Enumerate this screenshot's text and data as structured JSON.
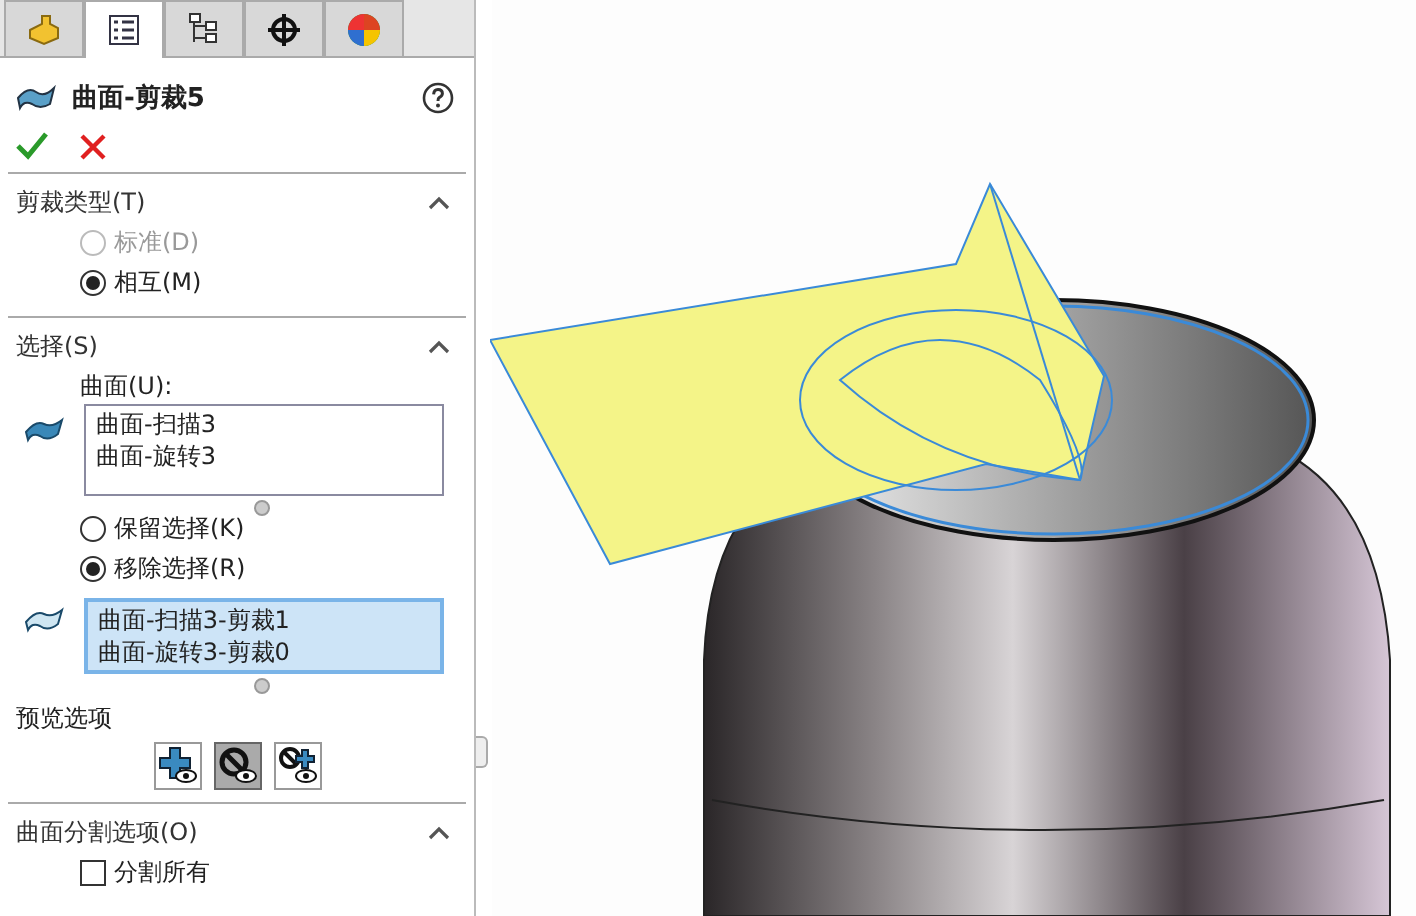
{
  "tabs": [
    {
      "kind": "feature-manager",
      "selected": false
    },
    {
      "kind": "property-manager",
      "selected": true
    },
    {
      "kind": "configuration-manager",
      "selected": false
    },
    {
      "kind": "dimxpert-manager",
      "selected": false
    },
    {
      "kind": "display-manager",
      "selected": false
    }
  ],
  "title": "曲面-剪裁5",
  "trim_type": {
    "title": "剪裁类型(T)",
    "expanded": true,
    "options": [
      {
        "label": "标准(D)",
        "selected": false,
        "disabled": true
      },
      {
        "label": "相互(M)",
        "selected": true,
        "disabled": false
      }
    ]
  },
  "selection": {
    "title": "选择(S)",
    "expanded": true,
    "surfaces_label": "曲面(U):",
    "surfaces": [
      "曲面-扫描3",
      "曲面-旋转3"
    ],
    "options": [
      {
        "label": "保留选择(K)",
        "selected": false,
        "disabled": false
      },
      {
        "label": "移除选择(R)",
        "selected": true,
        "disabled": false
      }
    ],
    "pieces": [
      "曲面-扫描3-剪裁1",
      "曲面-旋转3-剪裁0"
    ]
  },
  "preview": {
    "title": "预览选项",
    "buttons": [
      {
        "kind": "show-kept",
        "selected": false
      },
      {
        "kind": "hide-removed",
        "selected": true
      },
      {
        "kind": "show-removed",
        "selected": false
      }
    ]
  },
  "split": {
    "title": "曲面分割选项(O)",
    "expanded": true,
    "options": [
      {
        "label": "分割所有",
        "checked": false
      }
    ]
  }
}
